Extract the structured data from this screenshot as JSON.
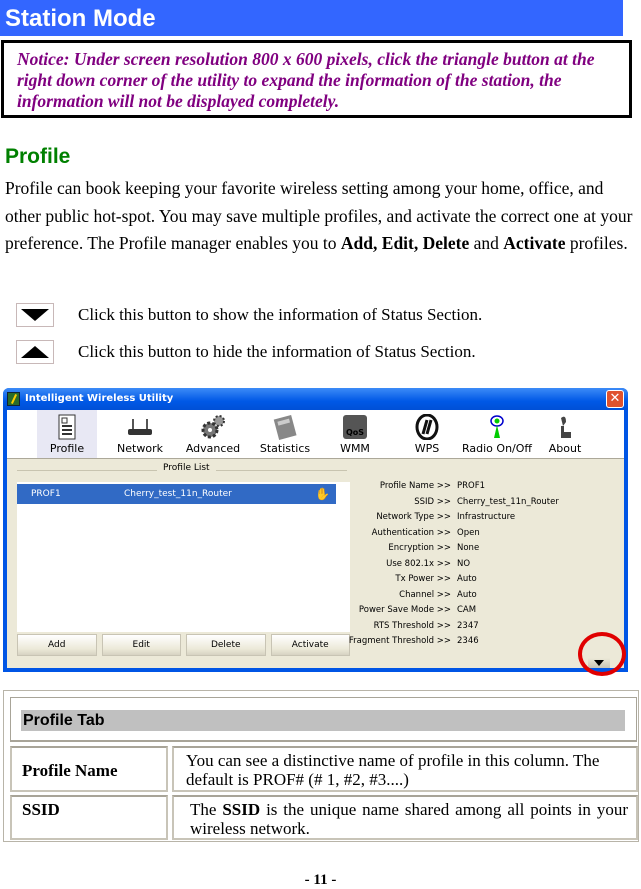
{
  "section_title": "Station Mode",
  "notice": "Notice: Under screen resolution 800 x 600 pixels, click the triangle button at the right down corner of the utility to expand the information of the station, the information will not be displayed completely.",
  "profile_heading": "Profile",
  "paragraph": {
    "part1": "Profile can book keeping your favorite wireless setting among your home, office, and other public hot-spot. You may save multiple profiles, and activate the correct one at your preference. The Profile manager enables you to ",
    "bold1": "Add, Edit, Delete",
    "part2": " and ",
    "bold2": "Activate",
    "part3": " profiles."
  },
  "buttons_help": [
    {
      "icon": "triangle-down-icon",
      "text": "Click this button to show the information of Status Section."
    },
    {
      "icon": "triangle-up-icon",
      "text": "Click this button to hide the information of Status Section."
    }
  ],
  "utility": {
    "title": "Intelligent Wireless Utility",
    "close": "✕",
    "toolbar": [
      {
        "label": "Profile",
        "icon": "profile-icon",
        "active": true
      },
      {
        "label": "Network",
        "icon": "network-router-icon"
      },
      {
        "label": "Advanced",
        "icon": "gears-icon"
      },
      {
        "label": "Statistics",
        "icon": "calculator-icon"
      },
      {
        "label": "WMM",
        "icon": "qos-icon"
      },
      {
        "label": "WPS",
        "icon": "wps-icon"
      },
      {
        "label": "Radio On/Off",
        "icon": "radio-antenna-icon"
      },
      {
        "label": "About",
        "icon": "about-icon"
      }
    ],
    "profile_list_label": "Profile List",
    "profiles": [
      {
        "name": "PROF1",
        "ssid": "Cherry_test_11n_Router",
        "active_icon": "active-profile-icon"
      }
    ],
    "actions": [
      "Add",
      "Edit",
      "Delete",
      "Activate"
    ],
    "details": [
      {
        "key": "Profile Name >>",
        "value": "PROF1"
      },
      {
        "key": "SSID >>",
        "value": "Cherry_test_11n_Router"
      },
      {
        "key": "Network Type >>",
        "value": "Infrastructure"
      },
      {
        "key": "Authentication >>",
        "value": "Open"
      },
      {
        "key": "Encryption >>",
        "value": "None"
      },
      {
        "key": "Use 802.1x >>",
        "value": "NO"
      },
      {
        "key": "Tx Power >>",
        "value": "Auto"
      },
      {
        "key": "Channel >>",
        "value": "Auto"
      },
      {
        "key": "Power Save Mode >>",
        "value": "CAM"
      },
      {
        "key": "RTS Threshold >>",
        "value": "2347"
      },
      {
        "key": "Fragment Threshold >>",
        "value": "2346"
      }
    ],
    "highlight_color": "#e00000"
  },
  "table": {
    "title": "Profile Tab",
    "rows": [
      {
        "key": "Profile Name",
        "value": "You can see a distinctive name of profile in this column. The default is PROF# (# 1, #2, #3....)"
      },
      {
        "key": "SSID",
        "value_pre": "The ",
        "value_bold": "SSID",
        "value_post": " is the unique name shared among all points in your wireless network."
      }
    ]
  },
  "page_number": "- 11 -",
  "colors": {
    "section_bar": "#3366ff",
    "notice_text": "#800080",
    "heading": "#008000",
    "selection": "#316ac5"
  }
}
